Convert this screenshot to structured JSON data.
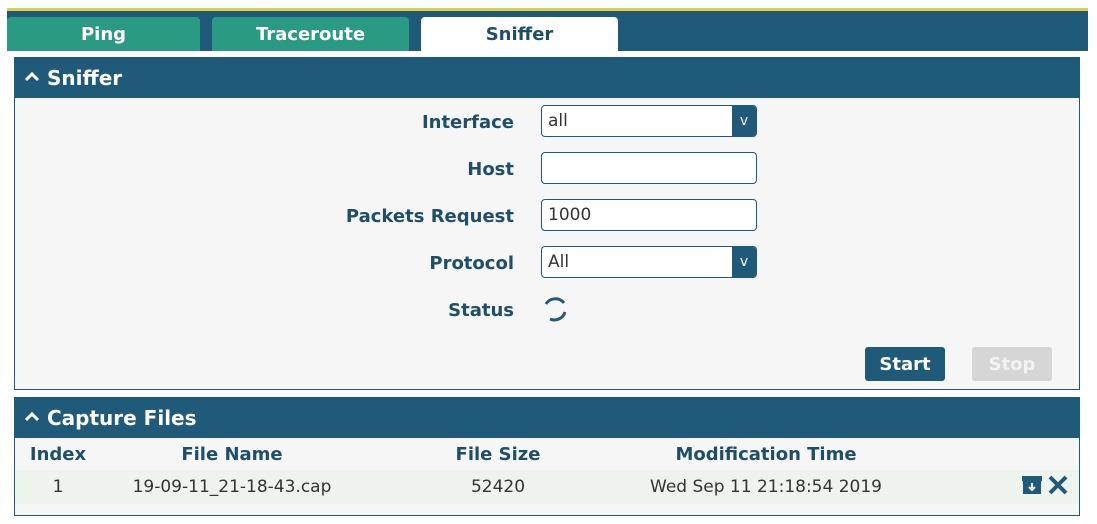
{
  "tabs": [
    {
      "label": "Ping",
      "active": false
    },
    {
      "label": "Traceroute",
      "active": false
    },
    {
      "label": "Sniffer",
      "active": true
    }
  ],
  "sniffer": {
    "title": "Sniffer",
    "interface_label": "Interface",
    "interface_value": "all",
    "host_label": "Host",
    "host_value": "",
    "packets_label": "Packets Request",
    "packets_value": "1000",
    "protocol_label": "Protocol",
    "protocol_value": "All",
    "status_label": "Status",
    "start_label": "Start",
    "stop_label": "Stop"
  },
  "capture": {
    "title": "Capture Files",
    "columns": [
      "Index",
      "File Name",
      "File Size",
      "Modification Time"
    ],
    "rows": [
      {
        "index": "1",
        "file_name": "19-09-11_21-18-43.cap",
        "file_size": "52420",
        "modified": "Wed Sep 11 21:18:54 2019"
      }
    ]
  },
  "colors": {
    "header": "#1f5a7b",
    "tab": "#2b9a83",
    "accent_line": "#d8d24a"
  },
  "icons": [
    "chevron-up-icon",
    "dropdown-arrow-icon",
    "loading-spinner-icon",
    "download-icon",
    "delete-x-icon"
  ]
}
